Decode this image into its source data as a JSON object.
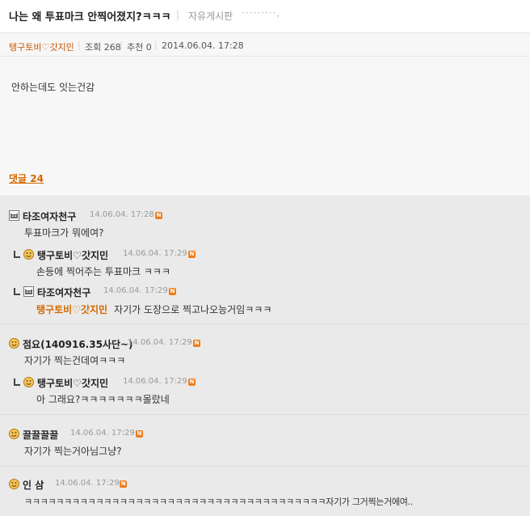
{
  "post": {
    "title": "나는 왜 투표마크 안찍어졌지?ㅋㅋㅋ",
    "board": "자유게시판",
    "board_dots": "·········,",
    "author": "탱구토비♡갓지민",
    "views": "조회 268",
    "recommend": "추천 0",
    "datetime": "2014.06.04. 17:28",
    "body": "안하는데도 잇는건감",
    "comment_count_label": "댓글 24"
  },
  "comments": [
    {
      "nick": "타조여자천구",
      "date": "14.06.04. 17:28",
      "text": "투표마크가 뭐에여?",
      "icon": "cat-icon"
    },
    {
      "nick": "탱구토비♡갓지민",
      "date": "14.06.04. 17:29",
      "text": "손등에 찍어주는 투표마크 ㅋㅋㅋ",
      "icon": "smiley-icon"
    },
    {
      "nick": "타조여자천구",
      "date": "14.06.04. 17:29",
      "mention": "탱구토비♡갓지민",
      "text": "자기가 도장으로 찍고나오능거임ㅋㅋㅋ",
      "icon": "cat-icon"
    },
    {
      "nick": "점요(140916.35사단~)",
      "date": "14.06.04. 17:29",
      "text": "자기가 찍는건데여ㅋㅋㅋ",
      "icon": "smiley-icon"
    },
    {
      "nick": "탱구토비♡갓지민",
      "date": "14.06.04. 17:29",
      "text": "아 그래요?ㅋㅋㅋㅋㅋㅋㅋ몰랐네",
      "icon": "smiley-icon"
    },
    {
      "nick": "끌끌끌끌",
      "date": "14.06.04. 17:29",
      "text": "자기가 찍는거아님그냥?",
      "icon": "smiley-icon"
    },
    {
      "nick": "인 삼",
      "date": "14.06.04. 17:29",
      "text": "ㅋㅋㅋㅋㅋㅋㅋㅋㅋㅋㅋㅋㅋㅋㅋㅋㅋㅋㅋㅋㅋㅋㅋㅋㅋㅋㅋㅋㅋㅋㅋㅋㅋㅋㅋㅋㅋㅋ자기가 그거찍는거에여..",
      "icon": "smiley-icon"
    }
  ],
  "new_badge": "N",
  "colors": {
    "accent": "#d36a00",
    "comments_bg": "#eaeaea",
    "post_bg": "#f7f7f7"
  }
}
